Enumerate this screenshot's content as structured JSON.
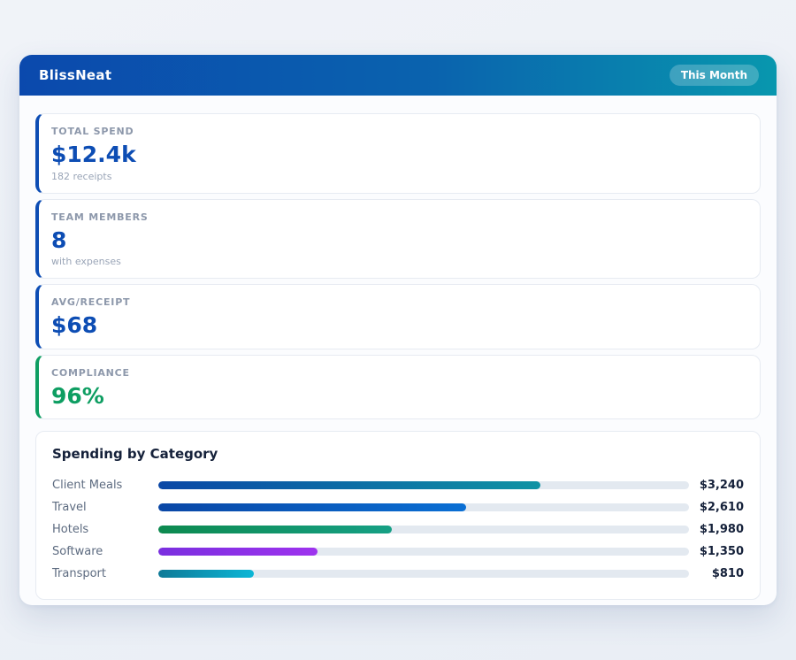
{
  "header": {
    "title": "BlissNeat",
    "badge": "This Month",
    "gradient_from": "#0b49ad",
    "gradient_to": "#0897ae"
  },
  "stats": [
    {
      "label": "TOTAL SPEND",
      "value": "$12.4k",
      "sub": "182 receipts",
      "accent": "#0d4db4",
      "value_color": "#0d4db4"
    },
    {
      "label": "TEAM MEMBERS",
      "value": "8",
      "sub": "with expenses",
      "accent": "#0d4db4",
      "value_color": "#0d4db4"
    },
    {
      "label": "AVG/RECEIPT",
      "value": "$68",
      "sub": "",
      "accent": "#0d4db4",
      "value_color": "#0d4db4"
    },
    {
      "label": "COMPLIANCE",
      "value": "96%",
      "sub": "",
      "accent": "#0e9e62",
      "value_color": "#0e9e62"
    }
  ],
  "chart_data": {
    "type": "bar",
    "orientation": "horizontal",
    "title": "Spending by Category",
    "categories": [
      "Client Meals",
      "Travel",
      "Hotels",
      "Software",
      "Transport"
    ],
    "values": [
      3240,
      2610,
      1980,
      1350,
      810
    ],
    "value_labels": [
      "$3,240",
      "$2,610",
      "$1,980",
      "$1,350",
      "$810"
    ],
    "xlim": [
      0,
      4500
    ],
    "track_color": "#e3e9f0",
    "bar_gradients": [
      [
        "#0a47a6",
        "#0f93a4"
      ],
      [
        "#0a47a6",
        "#0a6fd4"
      ],
      [
        "#0d8a4f",
        "#16a085"
      ],
      [
        "#7a2fdf",
        "#9e33ee"
      ],
      [
        "#0e7a97",
        "#0cb6d6"
      ]
    ]
  }
}
